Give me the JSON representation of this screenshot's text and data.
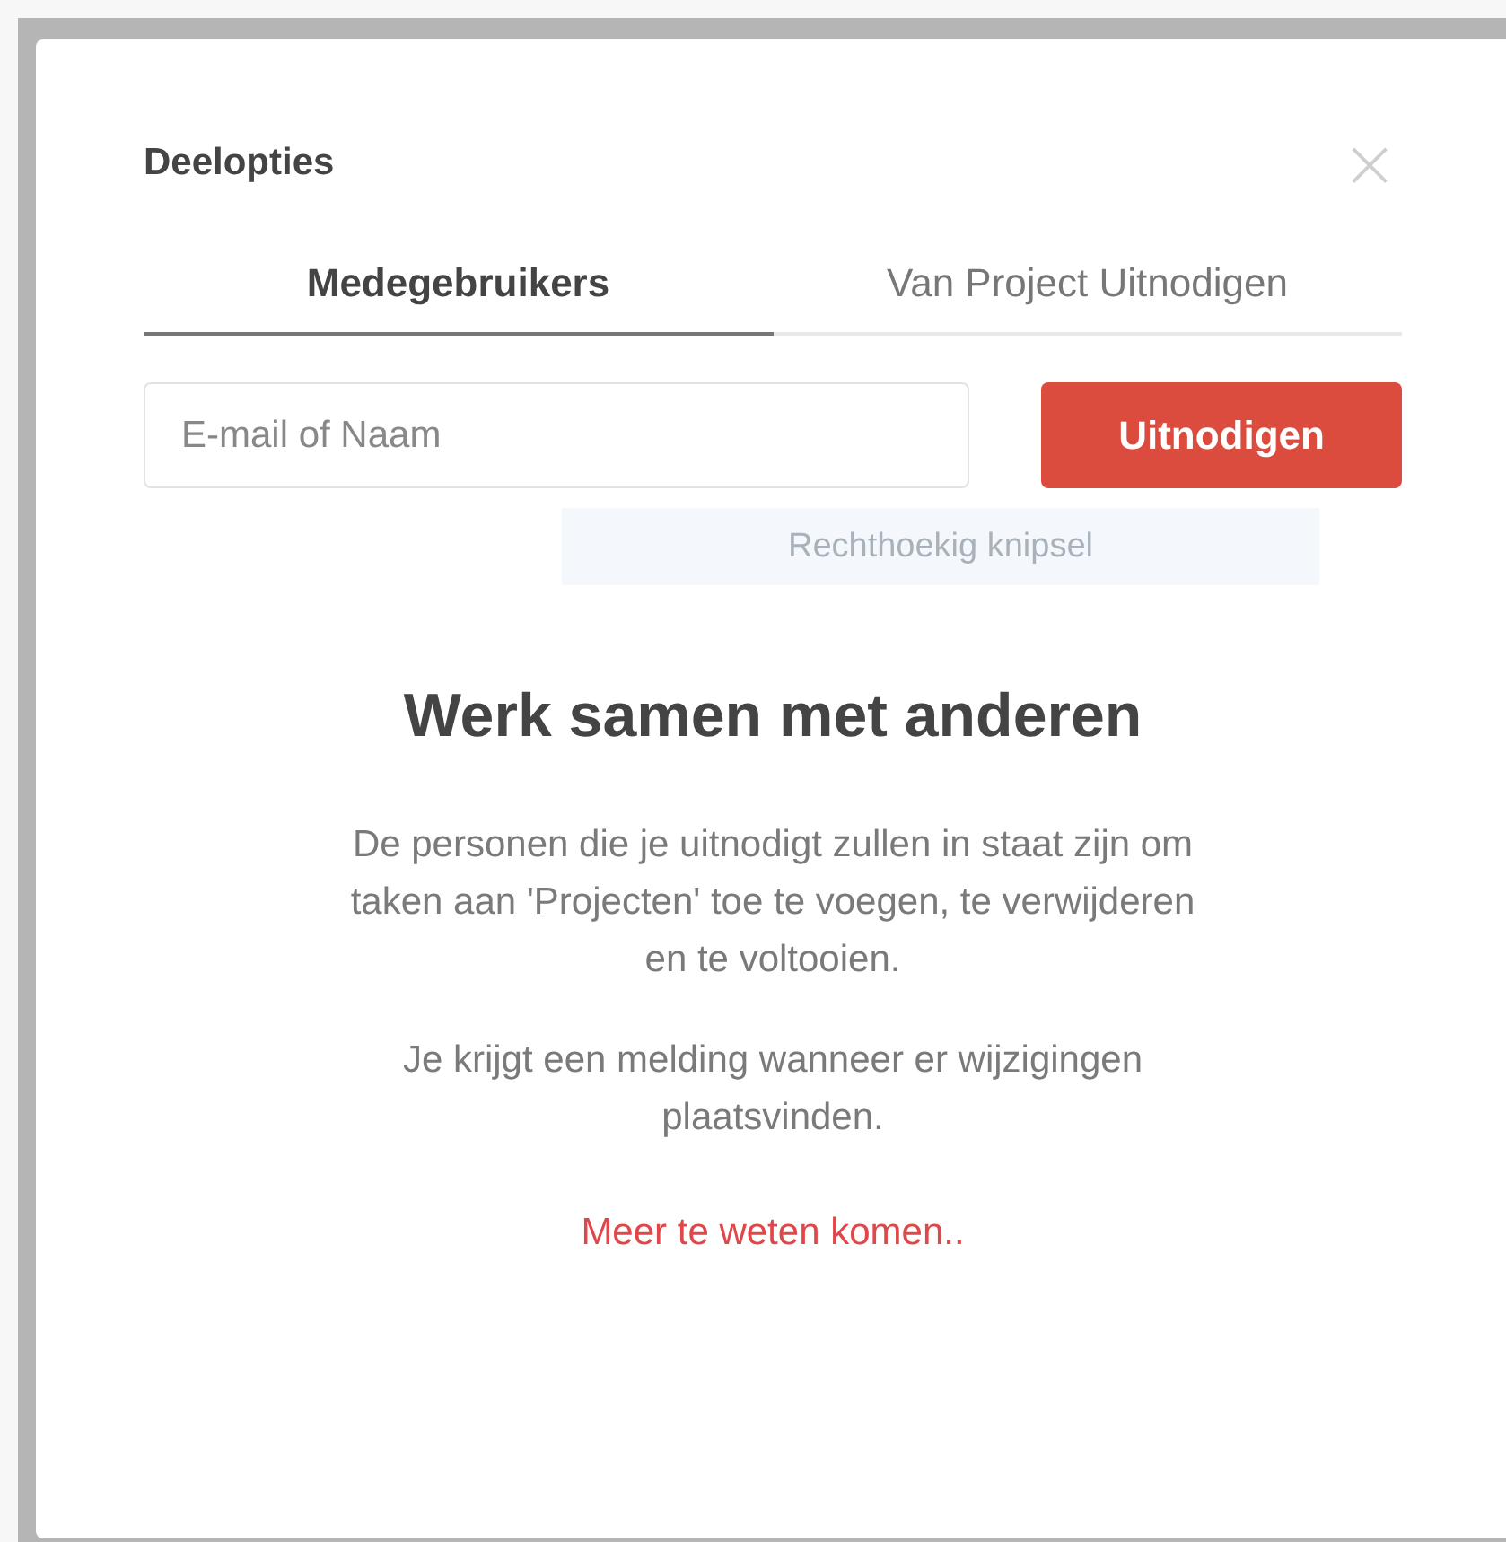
{
  "dialog": {
    "title": "Deelopties",
    "close": "×"
  },
  "tabs": [
    {
      "label": "Medegebruikers",
      "selected": true
    },
    {
      "label": "Van Project Uitnodigen",
      "selected": false
    }
  ],
  "invite": {
    "placeholder": "E-mail of Naam",
    "button": "Uitnodigen"
  },
  "tooltip": "Rechthoekig knipsel",
  "empty_state": {
    "heading": "Werk samen met anderen",
    "paragraphs": [
      "De personen die je uitnodigt zullen in staat zijn om taken aan 'Projecten' toe te voegen, te verwijderen en te voltooien.",
      "Je krijgt een melding wanneer er wijzigingen plaatsvinden."
    ],
    "link": "Meer te weten komen.."
  }
}
